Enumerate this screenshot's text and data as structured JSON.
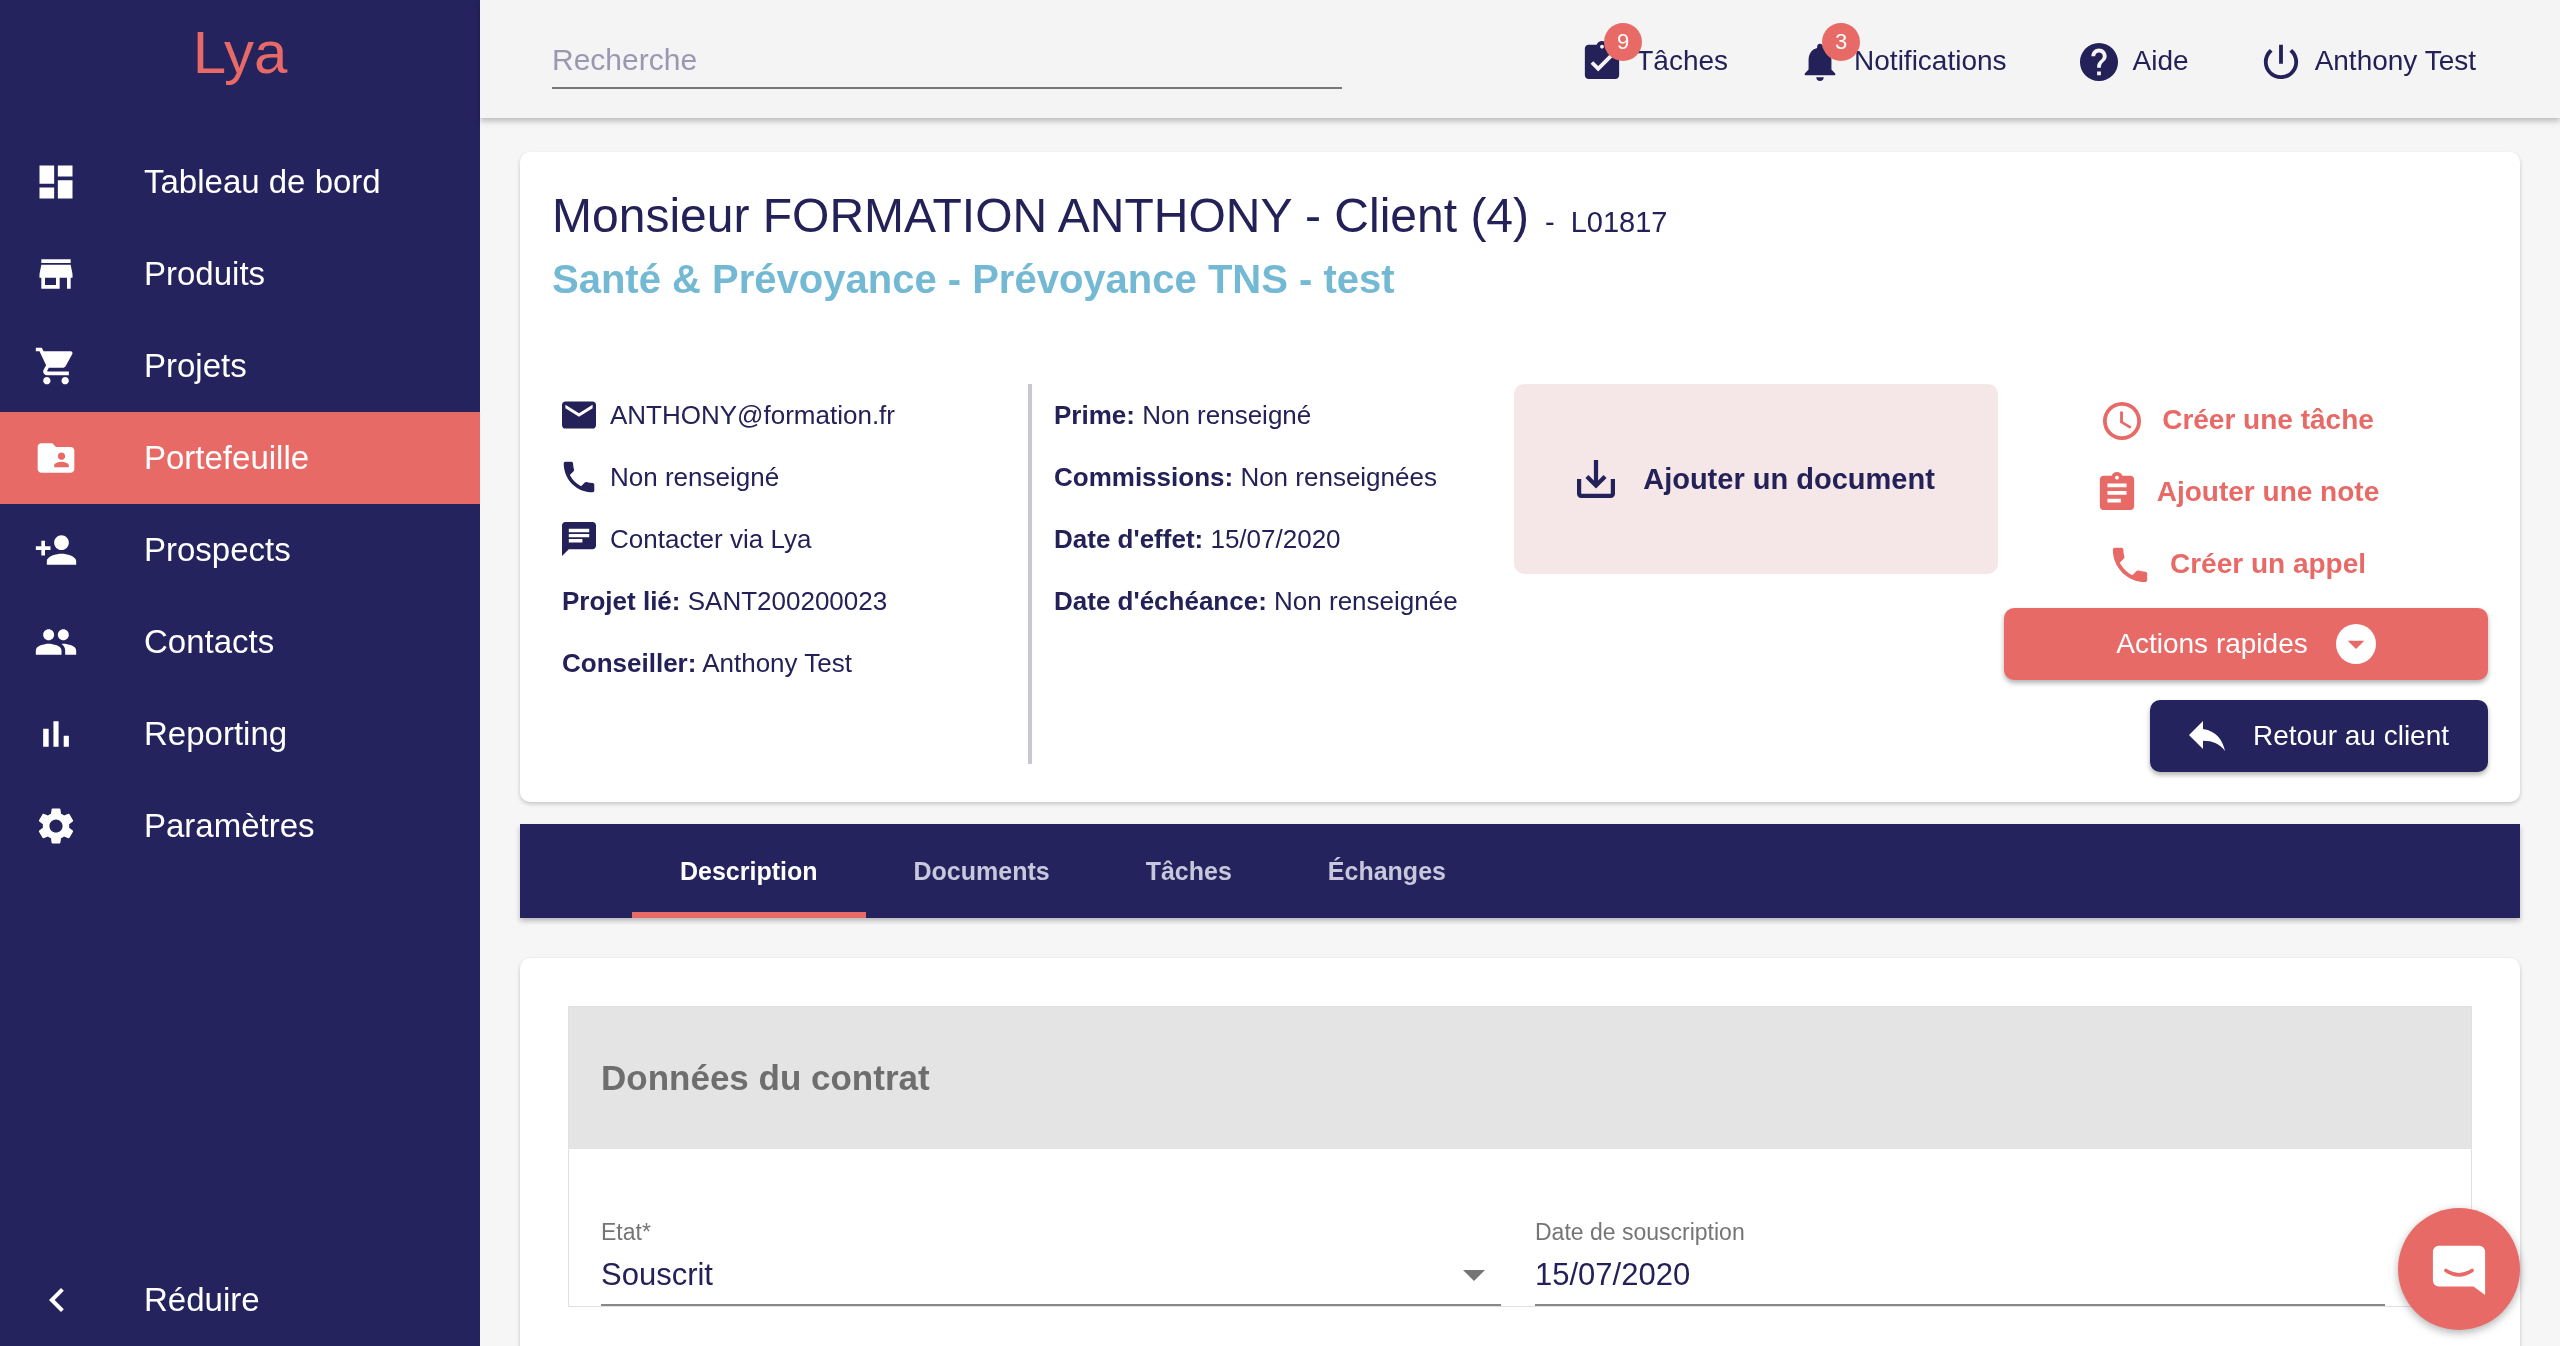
{
  "sidebar": {
    "logo": "Lya",
    "items": [
      {
        "label": "Tableau de bord",
        "selected": false
      },
      {
        "label": "Produits",
        "selected": false
      },
      {
        "label": "Projets",
        "selected": false
      },
      {
        "label": "Portefeuille",
        "selected": true
      },
      {
        "label": "Prospects",
        "selected": false
      },
      {
        "label": "Contacts",
        "selected": false
      },
      {
        "label": "Reporting",
        "selected": false
      },
      {
        "label": "Paramètres",
        "selected": false
      }
    ],
    "collapse": {
      "label": "Réduire"
    }
  },
  "topbar": {
    "search": {
      "placeholder": "Recherche"
    },
    "items": [
      {
        "label": "Tâches",
        "badge": "9"
      },
      {
        "label": "Notifications",
        "badge": "3"
      },
      {
        "label": "Aide"
      },
      {
        "label": "Anthony Test"
      }
    ]
  },
  "header": {
    "title": "Monsieur FORMATION ANTHONY - Client (4)",
    "separator": "-",
    "reference": "L01817",
    "subtitle": "Santé & Prévoyance - Prévoyance TNS - test",
    "contact": [
      {
        "text": "ANTHONY@formation.fr"
      },
      {
        "text": "Non renseigné"
      },
      {
        "text": "Contacter via Lya"
      },
      {
        "text": "**Projet lié:** SANT200200023"
      },
      {
        "text": "**Conseiller:** Anthony Test"
      }
    ],
    "details": [
      "**Prime:** Non renseigné",
      "**Commissions:** Non renseignées",
      "**Date d'effet:** 15/07/2020",
      "**Date d'échéance:** Non renseignée"
    ],
    "upload": {
      "label": "Ajouter un document"
    },
    "quick_links": [
      {
        "label": "Créer une tâche"
      },
      {
        "label": "Ajouter une note"
      },
      {
        "label": "Créer un appel"
      }
    ],
    "quick_actions": {
      "label": "Actions rapides"
    },
    "back": {
      "label": "Retour au client"
    }
  },
  "tabs": [
    {
      "label": "Description",
      "selected": true
    },
    {
      "label": "Documents",
      "selected": false
    },
    {
      "label": "Tâches",
      "selected": false
    },
    {
      "label": "Échanges",
      "selected": false
    }
  ],
  "section": {
    "title": "Données du contrat",
    "fields": [
      {
        "kind": "select",
        "label": "Etat*",
        "value": "Souscrit"
      },
      {
        "kind": "date",
        "label": "Date de souscription",
        "value": "15/07/2020"
      }
    ]
  }
}
